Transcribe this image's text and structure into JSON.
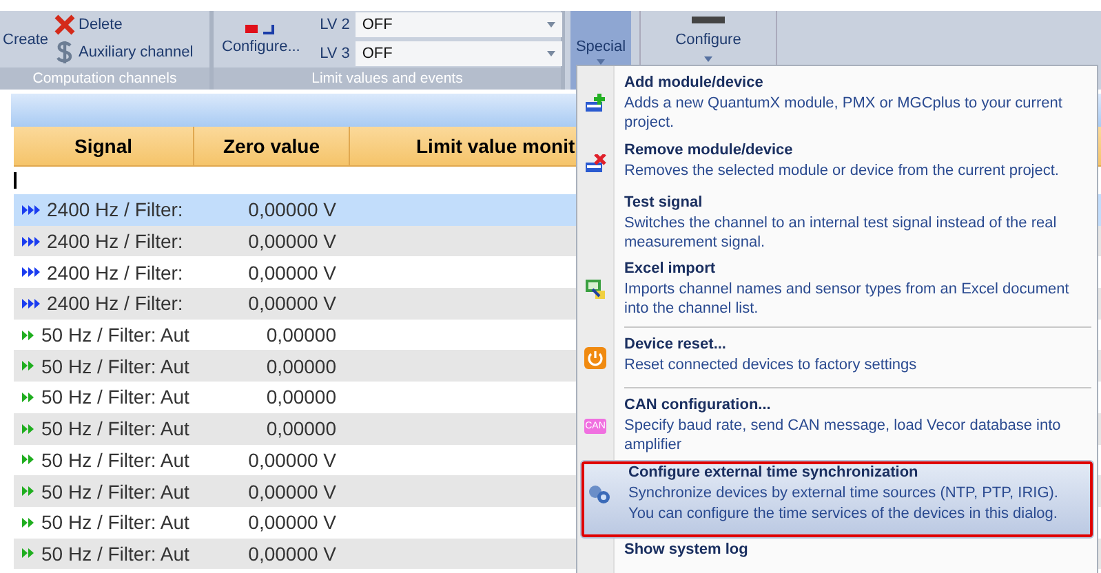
{
  "ribbon": {
    "groups": [
      {
        "label": "Computation channels",
        "buttons": [
          {
            "label": "Create",
            "kind": "create"
          },
          {
            "label": "Delete",
            "kind": "delete"
          },
          {
            "label": "Auxiliary channel",
            "kind": "aux"
          }
        ]
      },
      {
        "label": "Limit values and events",
        "configure": "Configure...",
        "limits": [
          {
            "label": "LV 2",
            "value": "OFF"
          },
          {
            "label": "LV 3",
            "value": "OFF"
          }
        ]
      }
    ],
    "special": {
      "label": "Special",
      "selected": true
    },
    "configure": {
      "label": "Configure"
    }
  },
  "table": {
    "columns": [
      "Signal",
      "Zero value",
      "Limit value monit"
    ],
    "rows": [
      {
        "kind": "fast",
        "signal": "2400 Hz / Filter:",
        "zero": "0,00000 V",
        "selected": true
      },
      {
        "kind": "fast",
        "signal": "2400 Hz / Filter:",
        "zero": "0,00000 V",
        "selected": false
      },
      {
        "kind": "fast",
        "signal": "2400 Hz / Filter:",
        "zero": "0,00000 V",
        "selected": false
      },
      {
        "kind": "fast",
        "signal": "2400 Hz / Filter:",
        "zero": "0,00000 V",
        "selected": false
      },
      {
        "kind": "slow",
        "signal": "50 Hz / Filter: Aut",
        "zero": "0,00000",
        "selected": false
      },
      {
        "kind": "slow",
        "signal": "50 Hz / Filter: Aut",
        "zero": "0,00000",
        "selected": false
      },
      {
        "kind": "slow",
        "signal": "50 Hz / Filter: Aut",
        "zero": "0,00000",
        "selected": false
      },
      {
        "kind": "slow",
        "signal": "50 Hz / Filter: Aut",
        "zero": "0,00000",
        "selected": false
      },
      {
        "kind": "slow",
        "signal": "50 Hz / Filter: Aut",
        "zero": "0,00000 V",
        "selected": false
      },
      {
        "kind": "slow",
        "signal": "50 Hz / Filter: Aut",
        "zero": "0,00000 V",
        "selected": false
      },
      {
        "kind": "slow",
        "signal": "50 Hz / Filter: Aut",
        "zero": "0,00000 V",
        "selected": false
      },
      {
        "kind": "slow",
        "signal": "50 Hz / Filter: Aut",
        "zero": "0,00000 V",
        "selected": false
      }
    ]
  },
  "menu": {
    "items": [
      {
        "kind": "add",
        "title": "Add module/device",
        "description": "Adds a new QuantumX module, PMX or MGCplus to your current project.",
        "selected": false,
        "outlined": false
      },
      {
        "kind": "remove",
        "title": "Remove module/device",
        "description": "Removes the selected module or device from the current project.",
        "selected": false,
        "outlined": false
      },
      {
        "kind": "plain",
        "title": "Test signal",
        "description": "Switches the channel to an internal test signal instead of the real measurement signal.",
        "selected": false,
        "outlined": false
      },
      {
        "kind": "import",
        "title": "Excel import",
        "description": "Imports channel names and sensor types from an Excel document into the channel list.",
        "selected": false,
        "outlined": false
      },
      {
        "kind": "reset",
        "title": "Device reset...",
        "description": "Reset connected devices to factory settings",
        "selected": false,
        "outlined": false
      },
      {
        "kind": "can",
        "title": "CAN configuration...",
        "description": "Specify baud rate, send CAN message, load Vecor database into amplifier",
        "icon_text": "CAN",
        "selected": false,
        "outlined": false
      },
      {
        "kind": "sync",
        "title": "Configure external time synchronization",
        "description": "Synchronize devices by external time sources (NTP, PTP, IRIG). You can configure the time services of the devices in this dialog.",
        "selected": true,
        "outlined": true
      },
      {
        "kind": "plain",
        "title": "Show system log",
        "selected": false,
        "outlined": false
      }
    ]
  }
}
